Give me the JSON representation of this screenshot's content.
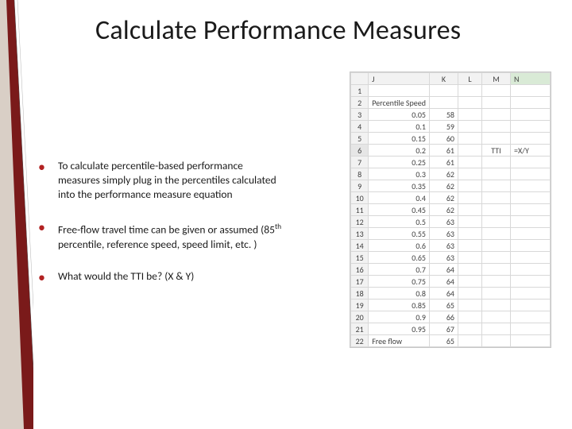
{
  "title": "Calculate Performance Measures",
  "bullets": [
    "To calculate percentile-based performance measures simply plug in the percentiles calculated into the performance measure equation",
    "Free-flow travel time can be given or assumed (85th percentile, reference speed, speed limit, etc. )",
    "What would the TTI be? (X & Y)"
  ],
  "spreadsheet": {
    "columns": [
      "J",
      "K",
      "L",
      "M",
      "N"
    ],
    "active_column": "N",
    "active_row": 6,
    "row2_label": "Percentile Speed",
    "formula_cell": "=X/Y",
    "tti_label": "TTI",
    "rows": [
      {
        "r": 1
      },
      {
        "r": 2,
        "J": "Percentile Speed"
      },
      {
        "r": 3,
        "J": "0.05",
        "K": "58"
      },
      {
        "r": 4,
        "J": "0.1",
        "K": "59"
      },
      {
        "r": 5,
        "J": "0.15",
        "K": "60"
      },
      {
        "r": 6,
        "J": "0.2",
        "K": "61",
        "M": "TTI",
        "N": "=X/Y"
      },
      {
        "r": 7,
        "J": "0.25",
        "K": "61"
      },
      {
        "r": 8,
        "J": "0.3",
        "K": "62"
      },
      {
        "r": 9,
        "J": "0.35",
        "K": "62"
      },
      {
        "r": 10,
        "J": "0.4",
        "K": "62"
      },
      {
        "r": 11,
        "J": "0.45",
        "K": "62"
      },
      {
        "r": 12,
        "J": "0.5",
        "K": "63"
      },
      {
        "r": 13,
        "J": "0.55",
        "K": "63"
      },
      {
        "r": 14,
        "J": "0.6",
        "K": "63"
      },
      {
        "r": 15,
        "J": "0.65",
        "K": "63"
      },
      {
        "r": 16,
        "J": "0.7",
        "K": "64"
      },
      {
        "r": 17,
        "J": "0.75",
        "K": "64"
      },
      {
        "r": 18,
        "J": "0.8",
        "K": "64"
      },
      {
        "r": 19,
        "J": "0.85",
        "K": "65"
      },
      {
        "r": 20,
        "J": "0.9",
        "K": "66"
      },
      {
        "r": 21,
        "J": "0.95",
        "K": "67"
      },
      {
        "r": 22,
        "J": "Free flow",
        "K": "65"
      }
    ]
  }
}
